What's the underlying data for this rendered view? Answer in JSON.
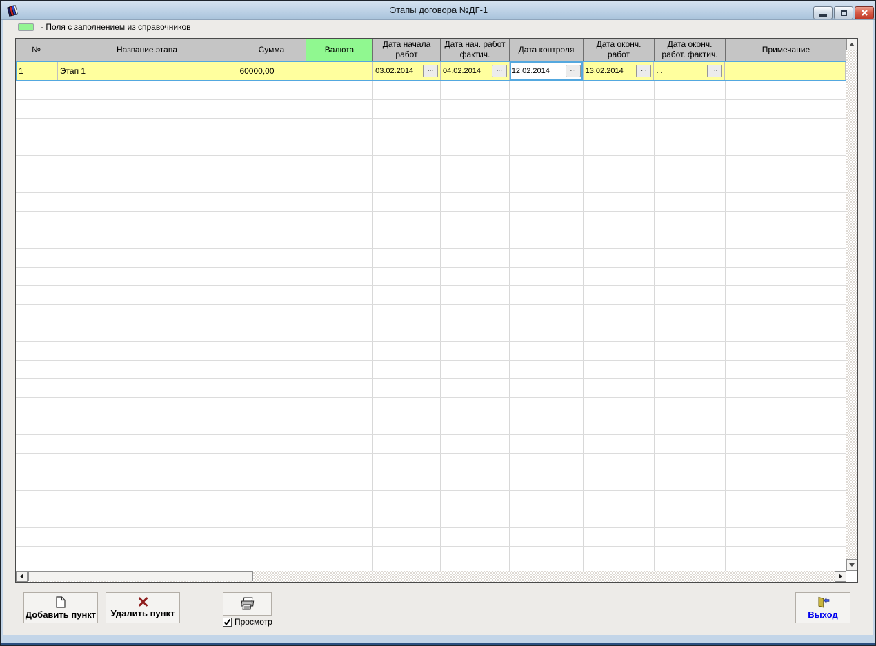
{
  "window": {
    "title": "Этапы договора №ДГ-1"
  },
  "legend": {
    "swatch_color": "#93F493",
    "text": "- Поля с заполнением из справочников"
  },
  "table": {
    "columns": [
      "№",
      "Название этапа",
      "Сумма",
      "Валюта",
      "Дата начала\nработ",
      "Дата нач. работ\nфактич.",
      "Дата контроля",
      "Дата оконч.\nработ",
      "Дата оконч.\nработ. фактич.",
      "Примечание"
    ],
    "highlight_column": "Валюта",
    "ellipsis": "...",
    "rows": [
      {
        "num": "1",
        "name": "Этап 1",
        "amount": "60000,00",
        "currency": "",
        "date_start": "03.02.2014",
        "date_start_fact": "04.02.2014",
        "date_control": "12.02.2014",
        "date_end": "13.02.2014",
        "date_end_fact": ". .",
        "note": ""
      }
    ],
    "focused_cell": "date_control",
    "empty_row_count": 27
  },
  "footer": {
    "add_label": "Добавить пункт",
    "delete_label": "Удалить пункт",
    "preview_label": "Просмотр",
    "preview_checked": true,
    "exit_label": "Выход"
  },
  "colors": {
    "reference_field_green": "#90F890",
    "active_row_yellow": "#FFFF9E",
    "focus_border_blue": "#54A8DF"
  }
}
